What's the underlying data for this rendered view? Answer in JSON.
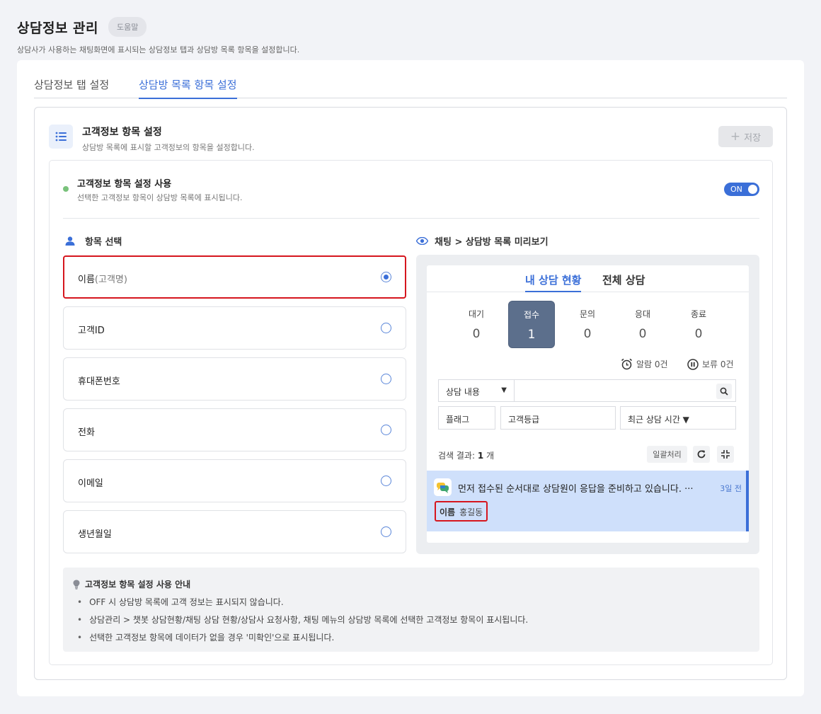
{
  "header": {
    "title": "상담정보 관리",
    "help_label": "도움말",
    "description": "상담사가 사용하는 채팅화면에 표시되는 상담정보 탭과 상담방 목록 항목을 설정합니다."
  },
  "tabs": [
    {
      "label": "상담정보 탭 설정"
    },
    {
      "label": "상담방 목록 항목 설정"
    }
  ],
  "section": {
    "title": "고객정보 항목 설정",
    "description": "상담방 목록에 표시할 고객정보의 항목을 설정합니다.",
    "save_label": "저장"
  },
  "usage": {
    "title": "고객정보 항목 설정 사용",
    "description": "선택한 고객정보 항목이 상담방 목록에 표시됩니다.",
    "toggle_label": "ON"
  },
  "selection": {
    "heading": "항목 선택",
    "options": [
      {
        "label": "이름",
        "sub": "(고객명)"
      },
      {
        "label": "고객ID"
      },
      {
        "label": "휴대폰번호"
      },
      {
        "label": "전화"
      },
      {
        "label": "이메일"
      },
      {
        "label": "생년월일"
      }
    ]
  },
  "preview": {
    "heading": "채팅 > 상담방 목록 미리보기",
    "tabs": [
      "내 상담 현황",
      "전체 상담"
    ],
    "stats": [
      {
        "label": "대기",
        "value": "0"
      },
      {
        "label": "접수",
        "value": "1"
      },
      {
        "label": "문의",
        "value": "0"
      },
      {
        "label": "응대",
        "value": "0"
      },
      {
        "label": "종료",
        "value": "0"
      }
    ],
    "alarm": "알람 0건",
    "hold": "보류 0건",
    "search_select": "상담 내용",
    "filters": [
      "플래그",
      "고객등급",
      "최근 상담 시간 ▼"
    ],
    "result_prefix": "검색 결과: ",
    "result_count": "1",
    "result_suffix": " 개",
    "bulk_label": "일괄처리",
    "chat": {
      "message": "먼저 접수된 순서대로 상담원이 응답을 준비하고 있습니다. ···",
      "time": "3일 전",
      "name_key": "이름",
      "name_value": "홍길동"
    }
  },
  "guide": {
    "title": "고객정보 항목 설정 사용 안내",
    "items": [
      "OFF 시 상담방 목록에 고객 정보는 표시되지 않습니다.",
      "상담관리 > 챗봇 상담현황/채팅 상담 현황/상담사 요청사항, 채팅 메뉴의 상담방 목록에 선택한 고객정보 항목이 표시됩니다.",
      "선택한 고객정보 항목에 데이터가 없을 경우 '미확인'으로 표시됩니다."
    ],
    "bullet": "•"
  },
  "colors": {
    "accent": "#3b6fd8",
    "highlight_border": "#d6161e",
    "active_stat": "#5c6f8c",
    "selected_chat_bg": "#cfe0fb"
  }
}
